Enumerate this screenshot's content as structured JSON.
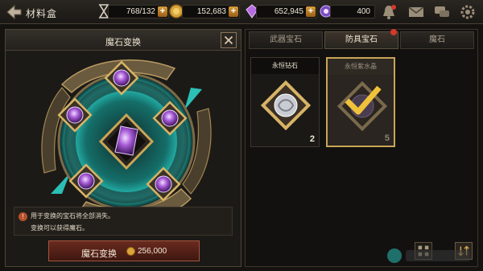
{
  "header": {
    "title": "材料盒",
    "stamina": "768/132",
    "gold": "152,683",
    "crystal": "652,945",
    "premium": "400"
  },
  "left_panel": {
    "title": "魔石变换",
    "info_lines": [
      "用于变换的宝石将全部消失。",
      "变换可以获得魔石。"
    ],
    "exchange_button": {
      "label": "魔石变换",
      "cost": "256,000"
    }
  },
  "right_panel": {
    "tabs": [
      {
        "label": "武器宝石",
        "active": false
      },
      {
        "label": "防具宝石",
        "active": true
      },
      {
        "label": "魔石",
        "active": false
      }
    ],
    "items": [
      {
        "name": "永恒钻石",
        "count": "2",
        "selected": false
      },
      {
        "name": "永恒紫水晶",
        "count": "5",
        "selected": true
      }
    ]
  },
  "colors": {
    "accent_gold": "#c9a655",
    "teal": "#1fa6a0",
    "amethyst": "#a77bd6",
    "button_red": "#6a2a1f"
  }
}
